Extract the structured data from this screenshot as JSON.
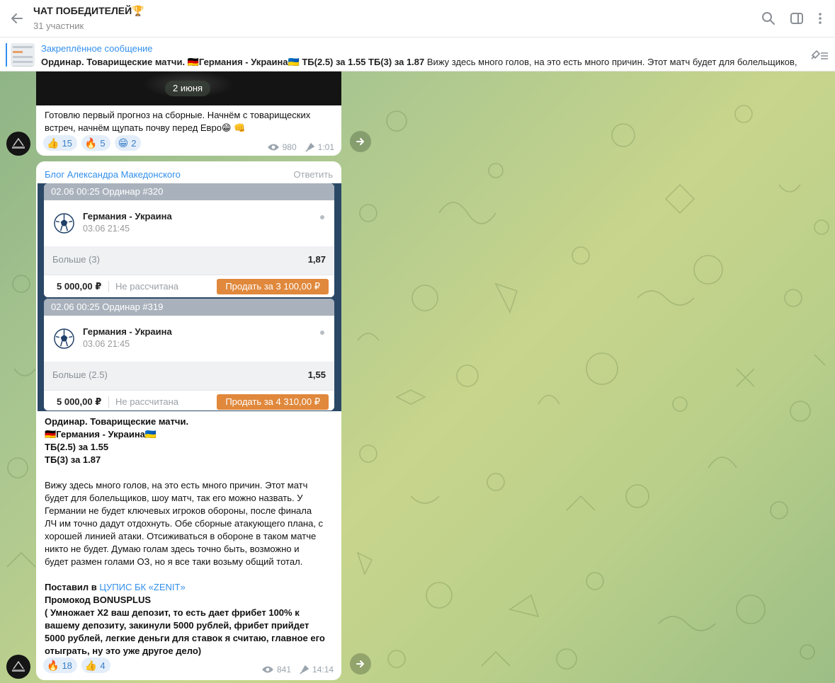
{
  "header": {
    "title": "ЧАТ ПОБЕДИТЕЛЕЙ🏆",
    "subtitle": "31 участник",
    "icons": [
      "back-arrow-icon",
      "search-icon",
      "sidebar-toggle-icon",
      "more-vertical-icon"
    ]
  },
  "pinned": {
    "label": "Закреплённое сообщение",
    "bold_part": "Ординар. Товарищеские матчи. 🇩🇪Германия - Украина🇺🇦 ТБ(2.5) за 1.55 ТБ(3) за 1.87",
    "rest": "  Вижу здесь много голов, на это есть много причин. Этот матч будет для болельщиков, шоу матч, так его можно назвать. У Германии не будет ключевых игроков обороны"
  },
  "messages": [
    {
      "date_pill": "2 июня",
      "text_line1": "Готовлю первый прогноз на сборные. Начнём с товарищеских",
      "text_line2": "встреч, начнём щупать почву перед Евро😁 👊",
      "reactions": [
        {
          "emoji": "👍",
          "count": "15"
        },
        {
          "emoji": "🔥",
          "count": "5"
        },
        {
          "emoji": "😁",
          "count": "2"
        }
      ],
      "views": "980",
      "time": "1:01"
    },
    {
      "author": "Блог Александра Македонского",
      "reply_label": "Ответить",
      "slips": [
        {
          "head": "02.06 00:25 Ординар  #320",
          "match": "Германия - Украина",
          "date": "03.06 21:45",
          "outcome": "Больше (3)",
          "odds": "1,87",
          "amount": "5 000,00 ₽",
          "status": "Не рассчитана",
          "sell": "Продать за 3 100,00 ₽"
        },
        {
          "head": "02.06 00:25 Ординар  #319",
          "match": "Германия - Украина",
          "date": "03.06 21:45",
          "outcome": "Больше (2.5)",
          "odds": "1,55",
          "amount": "5 000,00 ₽",
          "status": "Не рассчитана",
          "sell": "Продать за 4 310,00 ₽"
        }
      ],
      "bold_lines": [
        "Ординар. Товарищеские матчи.",
        "🇩🇪Германия - Украина🇺🇦",
        "ТБ(2.5) за 1.55",
        "ТБ(3) за 1.87"
      ],
      "paragraph": [
        "Вижу здесь много голов, на это есть много причин. Этот матч",
        "будет для болельщиков, шоу матч, так его можно назвать. У",
        "Германии не будет ключевых игроков обороны, после финала",
        "ЛЧ им точно дадут отдохнуть. Обе сборные атакующего плана, с",
        "хорошей линией атаки. Отсиживаться в обороне в таком матче",
        "никто не будет. Думаю голам здесь точно быть, возможно и",
        "будет размен голами ОЗ, но я все таки возьму общий тотал."
      ],
      "placed_prefix": "Поставил в ",
      "placed_link": "ЦУПИС БК «ZENIT»",
      "promo": "Промокод BONUSPLUS",
      "promo_lines": [
        "( Умножает Х2 ваш депозит, то есть дает фрибет 100% к",
        "вашему депозиту, закинули 5000 рублей, фрибет прийдет",
        "5000 рублей, легкие деньги для ставок я считаю, главное его",
        "отыграть, ну это уже другое дело)"
      ],
      "reactions": [
        {
          "emoji": "🔥",
          "count": "18"
        },
        {
          "emoji": "👍",
          "count": "4"
        }
      ],
      "views": "841",
      "time": "14:14"
    }
  ],
  "colors": {
    "accent": "#3390ec",
    "sell_button": "#e0883c",
    "slip_frame": "#2a4866"
  }
}
